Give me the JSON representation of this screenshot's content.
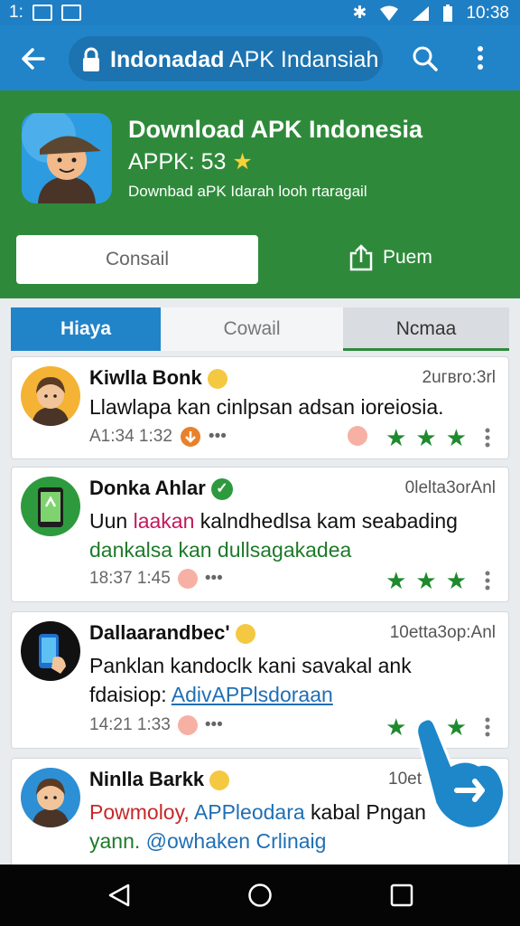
{
  "status_bar": {
    "left_text": "1:",
    "time": "10:38"
  },
  "app_bar": {
    "url_bold": "Indonadad",
    "url_rest": " APK Indansiah"
  },
  "app_header": {
    "title": "Download APK Indonesia",
    "version": "APPK: 53",
    "subtitle": "Downbad aPK Idarah looh rtaragail",
    "primary_button": "Consail",
    "share_button": "Puem"
  },
  "tabs": [
    {
      "label": "Hiaya"
    },
    {
      "label": "Cowail"
    },
    {
      "label": "Ncmaa"
    }
  ],
  "messages": [
    {
      "name": "Kiwlla Bonk",
      "time": "2uгвro:3rl",
      "line1": "Llawlapa kan cinlpsan adsan ioreiosia.",
      "meta": "A1:34 1:32"
    },
    {
      "name": "Donka Ahlar",
      "time": "0lelta3orAnl",
      "line1a": "Uun ",
      "line1b": "laakan",
      "line1c": " kalndhedlsa kam seabading",
      "line2": "dankalsa kan dullsagakadea",
      "meta": "18:37 1:45"
    },
    {
      "name": "Dallaarandbec'",
      "time": "10etta3op:Anl",
      "line1": "Panklan kandoclk kani savakal ank",
      "line2a": "fdaisiop: ",
      "line2b": "AdivAPPlsdoraan",
      "meta": "14:21 1:33"
    },
    {
      "name": "Ninlla Barkk",
      "time": "10et",
      "line1a": "Powmoloy, ",
      "line1b": "APPleodara",
      "line1c": " kabal Pngan",
      "line2a": "yann. ",
      "line2b": "@owhaken Crlinaig"
    }
  ],
  "colors": {
    "blue": "#2184c8",
    "green": "#2e8a3a",
    "star": "#1e8a2e"
  }
}
